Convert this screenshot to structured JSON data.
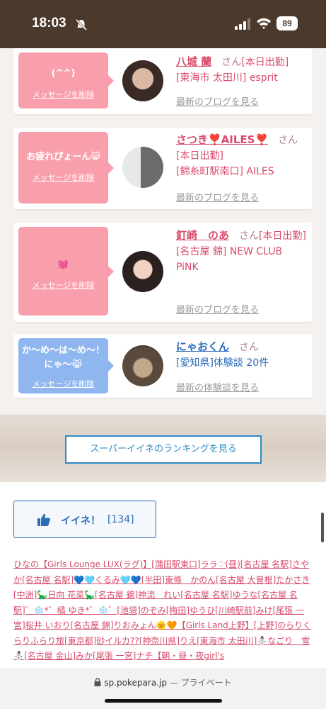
{
  "status_bar": {
    "time": "18:03",
    "battery": "89"
  },
  "feed": {
    "delete_label": "メッセージを削除",
    "blog_label": "最新のブログを見る",
    "review_label": "最新の体験談を見る",
    "san": "さん",
    "items": [
      {
        "message": "(^^)",
        "name": "八城 蘭",
        "line1": "[本日出勤]",
        "line2": "[東海市 太田川] esprit"
      },
      {
        "message": "お疲れぴょーん😸",
        "name": "さつき❣️AILES❣️",
        "line1": "[本日出勤]",
        "line2": "[錦糸町駅南口] AILES"
      },
      {
        "message": "💓",
        "name": "釘崎　のあ",
        "line1": "[本日出勤]",
        "line2": "[名古屋 錦] NEW CLUB PiNK"
      },
      {
        "message": "か〜め〜は〜め〜！にゃ〜😹",
        "name": "にゃおくん",
        "line1": "[愛知県]体験談 20件"
      }
    ]
  },
  "ranking_button": "スーパーイイネのランキングを見る",
  "like_button": {
    "label": "イイネ！",
    "count": "[134]"
  },
  "likers": [
    "ひなの【Girls Lounge LUX(ラグ)】[蒲田駅東口]",
    "ララ♡(昼)[名古屋 名駅]",
    "さやか[名古屋 名駅]💙🩵くるみ🩵💙[半田]",
    "東條　かのん[名古屋 大曽根]",
    "たかさき[中洲]🦕日向 花菜🦕[名古屋 錦]",
    "神流　れい[名古屋 名駅]",
    "ゆうな[名古屋 名駅]",
    "゛❄️*゛橘 ゆき*゛❄️゛[池袋]",
    "のぞみ[梅田]",
    "ゆうひ[川崎駅前]",
    "みけ[尾張 一宮]",
    "桜井 いおり[名古屋 錦]",
    "りおみょん🌞🧡【Girls Land上野】[上野]",
    "のらりくらりふらり旅[東京都]",
    "砂イルカ??[神奈川県]",
    "りえ[東海市 太田川]",
    "⛄なごり　雪⛄[名古屋 金山]",
    "みか[尾張 一宮]",
    "ナチ【朝・昼・夜girl's"
  ],
  "url_bar": {
    "domain": "sp.pokepara.jp",
    "suffix": "— プライベート"
  }
}
